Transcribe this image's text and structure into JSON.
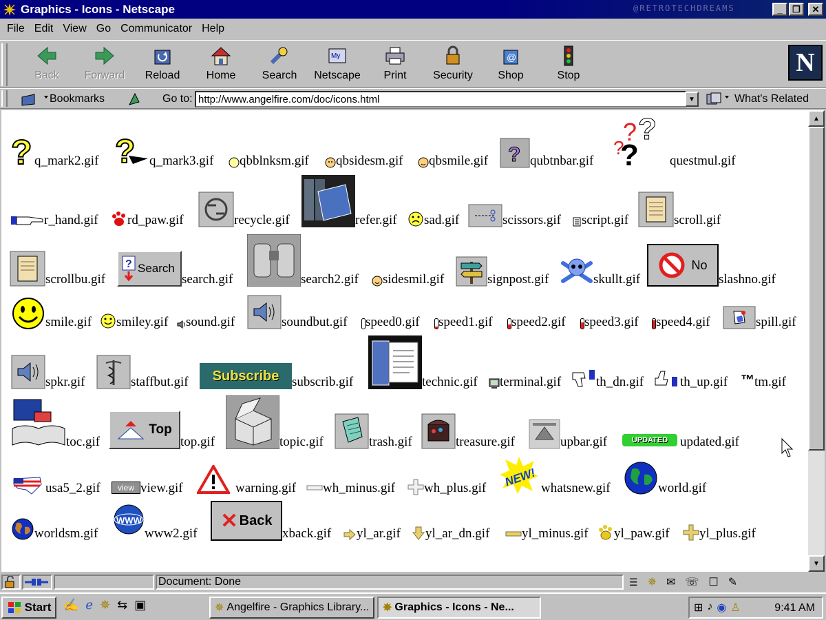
{
  "window": {
    "title": "Graphics - Icons - Netscape",
    "watermark": "@RETROTECHDREAMS"
  },
  "menu": [
    "File",
    "Edit",
    "View",
    "Go",
    "Communicator",
    "Help"
  ],
  "nav": {
    "back": "Back",
    "forward": "Forward",
    "reload": "Reload",
    "home": "Home",
    "search": "Search",
    "netscape": "Netscape",
    "print": "Print",
    "security": "Security",
    "shop": "Shop",
    "stop": "Stop"
  },
  "location": {
    "bookmarks": "Bookmarks",
    "goto": "Go to:",
    "url": "http://www.angelfire.com/doc/icons.html",
    "related": "What's Related"
  },
  "gifs": {
    "q_mark2": "q_mark2.gif",
    "q_mark3": "q_mark3.gif",
    "qbblnksm": "qbblnksm.gif",
    "qbsidesm": "qbsidesm.gif",
    "qbsmile": "qbsmile.gif",
    "qubtnbar": "qubtnbar.gif",
    "questmul": "questmul.gif",
    "r_hand": "r_hand.gif",
    "rd_paw": "rd_paw.gif",
    "recycle": "recycle.gif",
    "refer": "refer.gif",
    "sad": "sad.gif",
    "scissors": "scissors.gif",
    "script": "script.gif",
    "scroll": "scroll.gif",
    "scrollbu": "scrollbu.gif",
    "search": "search.gif",
    "search2": "search2.gif",
    "sidesmil": "sidesmil.gif",
    "signpost": "signpost.gif",
    "skullt": "skullt.gif",
    "slashno": "slashno.gif",
    "smile": "smile.gif",
    "smiley": "smiley.gif",
    "sound": "sound.gif",
    "soundbut": "soundbut.gif",
    "speed0": "speed0.gif",
    "speed1": "speed1.gif",
    "speed2": "speed2.gif",
    "speed3": "speed3.gif",
    "speed4": "speed4.gif",
    "spill": "spill.gif",
    "spkr": "spkr.gif",
    "staffbut": "staffbut.gif",
    "subscrib": "subscrib.gif",
    "technic": "technic.gif",
    "terminal": "terminal.gif",
    "th_dn": "th_dn.gif",
    "th_up": "th_up.gif",
    "tm": "tm.gif",
    "toc": "toc.gif",
    "top": "top.gif",
    "topic": "topic.gif",
    "trash": "trash.gif",
    "treasure": "treasure.gif",
    "upbar": "upbar.gif",
    "updated": "updated.gif",
    "usa5_2": "usa5_2.gif",
    "view": "view.gif",
    "warning": "warning.gif",
    "wh_minus": "wh_minus.gif",
    "wh_plus": "wh_plus.gif",
    "whatsnew": "whatsnew.gif",
    "world": "world.gif",
    "worldsm": "worldsm.gif",
    "www2": "www2.gif",
    "xback": "xback.gif",
    "yl_ar": "yl_ar.gif",
    "yl_ar_dn": "yl_ar_dn.gif",
    "yl_minus": "yl_minus.gif",
    "yl_paw": "yl_paw.gif",
    "yl_plus": "yl_plus.gif"
  },
  "icon_text": {
    "search_btn": "Search",
    "no_btn": "No",
    "subscribe": "Subscribe",
    "top_btn": "Top",
    "updated": "UPDATED",
    "new": "NEW!",
    "view": "view",
    "back_btn": "Back",
    "tm": "™",
    "www": "WWW"
  },
  "status": {
    "text": "Document: Done"
  },
  "taskbar": {
    "start": "Start",
    "tasks": [
      "Angelfire - Graphics Library...",
      "Graphics - Icons - Ne..."
    ],
    "clock": "9:41 AM"
  }
}
